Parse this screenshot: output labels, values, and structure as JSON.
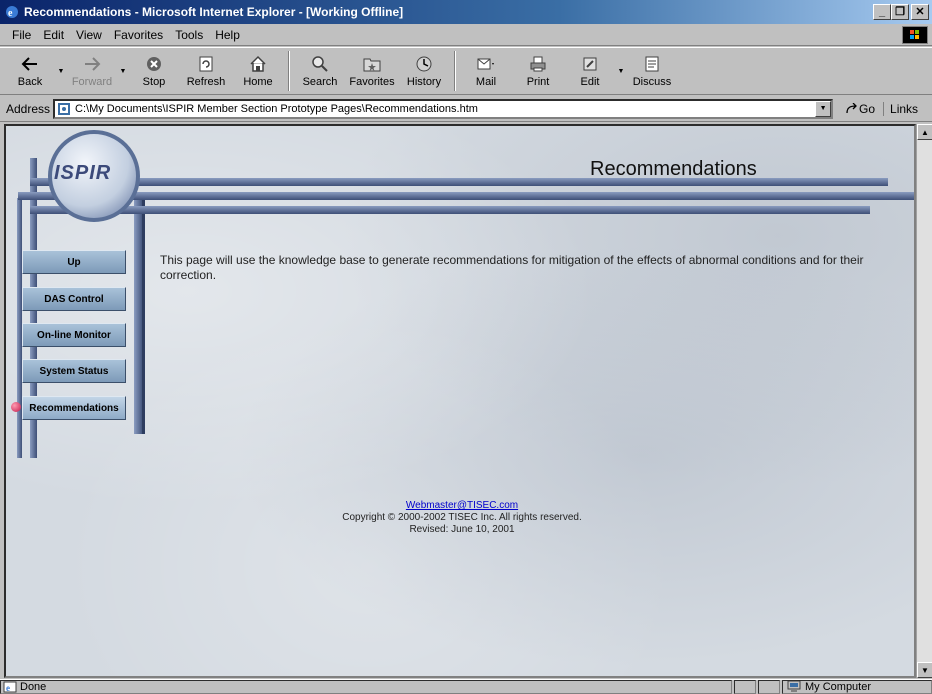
{
  "window": {
    "title": "Recommendations - Microsoft Internet Explorer - [Working Offline]",
    "minimize": "_",
    "restore": "❐",
    "close": "✕"
  },
  "menu": [
    {
      "label": "File"
    },
    {
      "label": "Edit"
    },
    {
      "label": "View"
    },
    {
      "label": "Favorites"
    },
    {
      "label": "Tools"
    },
    {
      "label": "Help"
    }
  ],
  "toolbar": {
    "back": "Back",
    "forward": "Forward",
    "stop": "Stop",
    "refresh": "Refresh",
    "home": "Home",
    "search": "Search",
    "favorites": "Favorites",
    "history": "History",
    "mail": "Mail",
    "print": "Print",
    "edit": "Edit",
    "discuss": "Discuss"
  },
  "address": {
    "label": "Address",
    "url": "C:\\My Documents\\ISPIR Member Section Prototype Pages\\Recommendations.htm",
    "go": "Go",
    "links": "Links"
  },
  "page": {
    "logo": "ISPIR",
    "title": "Recommendations",
    "nav": [
      {
        "label": "Up"
      },
      {
        "label": "DAS Control"
      },
      {
        "label": "On-line Monitor"
      },
      {
        "label": "System Status"
      },
      {
        "label": "Recommendations"
      }
    ],
    "body": "This page will use the knowledge base to generate recommendations for mitigation of the effects of abnormal conditions and for their correction.",
    "footer": {
      "email": "Webmaster@TISEC.com",
      "copyright": "Copyright © 2000-2002 TISEC Inc.  All rights reserved.",
      "revised": "Revised: June 10, 2001"
    }
  },
  "status": {
    "text": "Done",
    "zone": "My Computer"
  },
  "colors": {
    "titlebar": "#0a246a",
    "frame": "#5a6f96",
    "nav_button": "#8eaac7",
    "link": "#0000cc"
  }
}
